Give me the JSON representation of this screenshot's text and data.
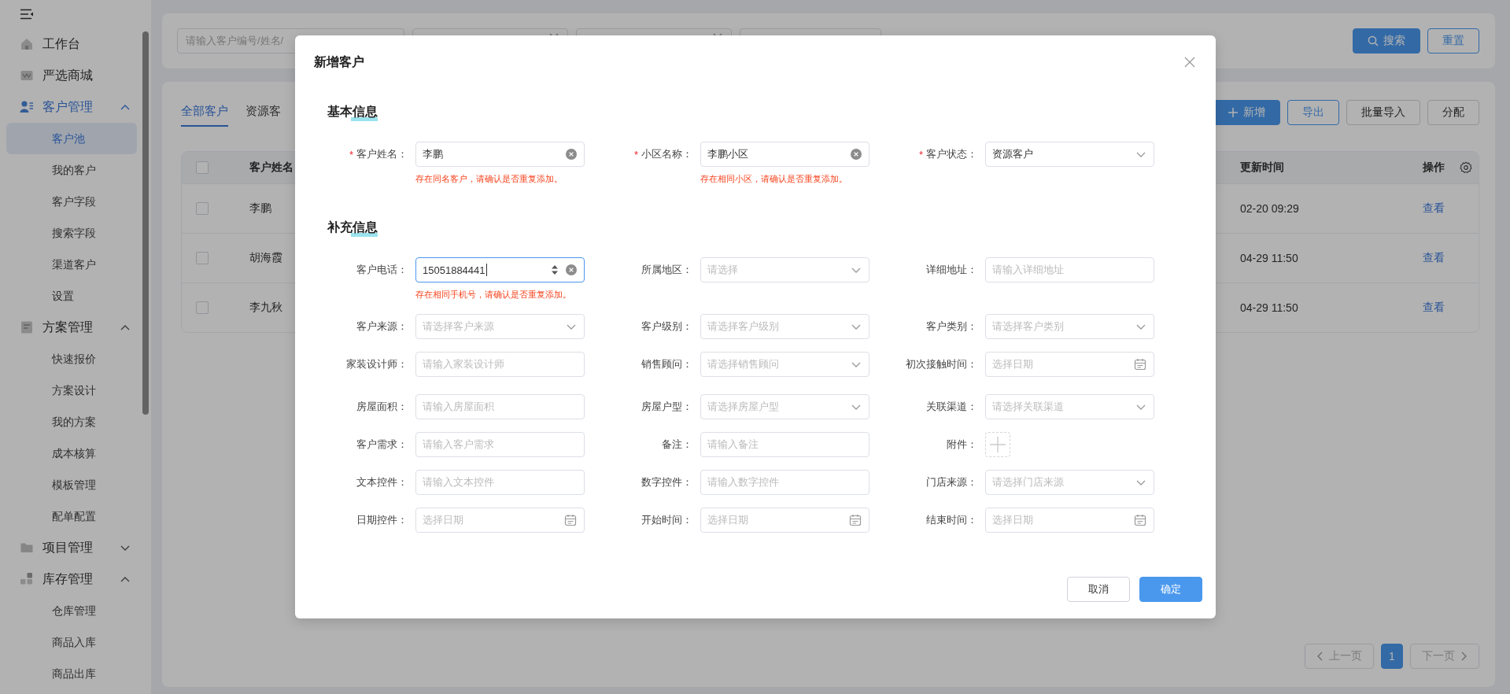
{
  "sidebar": {
    "items": [
      {
        "label": "工作台",
        "active": false
      },
      {
        "label": "严选商城",
        "active": false
      },
      {
        "label": "客户管理",
        "active": true,
        "expanded": true,
        "children": [
          {
            "label": "客户池",
            "selected": true
          },
          {
            "label": "我的客户",
            "selected": false
          },
          {
            "label": "客户字段",
            "selected": false
          },
          {
            "label": "搜索字段",
            "selected": false
          },
          {
            "label": "渠道客户",
            "selected": false
          },
          {
            "label": "设置",
            "selected": false
          }
        ]
      },
      {
        "label": "方案管理",
        "active": false,
        "expanded": true,
        "children": [
          {
            "label": "快速报价",
            "selected": false
          },
          {
            "label": "方案设计",
            "selected": false
          },
          {
            "label": "我的方案",
            "selected": false
          },
          {
            "label": "成本核算",
            "selected": false
          },
          {
            "label": "模板管理",
            "selected": false
          },
          {
            "label": "配单配置",
            "selected": false
          }
        ]
      },
      {
        "label": "项目管理",
        "active": false,
        "expanded": false
      },
      {
        "label": "库存管理",
        "active": false,
        "expanded": true,
        "children": [
          {
            "label": "仓库管理",
            "selected": false
          },
          {
            "label": "商品入库",
            "selected": false
          },
          {
            "label": "商品出库",
            "selected": false
          }
        ]
      }
    ]
  },
  "filter_bar": {
    "fields": [
      {
        "kind": "input",
        "placeholder": "请输入客户编号/姓名/"
      },
      {
        "kind": "select"
      },
      {
        "kind": "select"
      },
      {
        "kind": "input"
      }
    ],
    "buttons": [
      {
        "label": "搜索",
        "kind": "search"
      },
      {
        "label": "重置",
        "kind": "outline"
      }
    ]
  },
  "tabs": [
    {
      "label": "全部客户",
      "selected": true
    },
    {
      "label": "资源客",
      "selected": false
    }
  ],
  "toolbar": [
    {
      "label": "新增",
      "kind": "add"
    },
    {
      "label": "导出",
      "kind": "outline"
    },
    {
      "label": "批量导入",
      "kind": "default"
    },
    {
      "label": "分配",
      "kind": "default"
    }
  ],
  "table": {
    "select_all": {
      "checked": false
    },
    "columns": [
      "客户姓名",
      "更新时间",
      "操作"
    ],
    "rows": [
      {
        "checked": false,
        "name": "李鹏",
        "updated": "02-20 09:29",
        "action": "查看"
      },
      {
        "checked": false,
        "name": "胡海霞",
        "updated": "04-29 11:50",
        "action": "查看"
      },
      {
        "checked": false,
        "name": "李九秋",
        "updated": "04-29 11:50",
        "action": "查看"
      }
    ]
  },
  "pagination": {
    "prev": {
      "label": "上一页",
      "disabled": true
    },
    "pages": [
      {
        "label": "1",
        "selected": true
      }
    ],
    "next": {
      "label": "下一页",
      "disabled": true
    }
  },
  "dialog": {
    "title": "新增客户",
    "sections": [
      {
        "title": "基本信息",
        "rows": [
          [
            {
              "label": "客户姓名：",
              "required_mark": "*",
              "kind": "text",
              "value": "李鹏",
              "clearable": true,
              "focused": false,
              "error": "存在同名客户，请确认是否重复添加。"
            },
            {
              "label": "小区名称：",
              "required_mark": "*",
              "kind": "text",
              "value": "李鹏小区",
              "clearable": true,
              "focused": false,
              "error": "存在相同小区，请确认是否重复添加。"
            },
            {
              "label": "客户状态：",
              "required_mark": "*",
              "kind": "select",
              "value": "资源客户",
              "focused": false
            }
          ]
        ]
      },
      {
        "title": "补充信息",
        "rows": [
          [
            {
              "label": "客户电话：",
              "kind": "number",
              "value": "15051884441",
              "clearable": true,
              "focused": true,
              "error": "存在相同手机号，请确认是否重复添加。"
            },
            {
              "label": "所属地区：",
              "kind": "select",
              "placeholder": "请选择",
              "focused": false
            },
            {
              "label": "详细地址：",
              "kind": "text",
              "placeholder": "请输入详细地址",
              "focused": false
            }
          ],
          [
            {
              "label": "客户来源：",
              "kind": "select",
              "placeholder": "请选择客户来源",
              "focused": false
            },
            {
              "label": "客户级别：",
              "kind": "select",
              "placeholder": "请选择客户级别",
              "focused": false
            },
            {
              "label": "客户类别：",
              "kind": "select",
              "placeholder": "请选择客户类别",
              "focused": false
            }
          ],
          [
            {
              "label": "家装设计师：",
              "kind": "text",
              "placeholder": "请输入家装设计师",
              "focused": false
            },
            {
              "label": "销售顾问：",
              "kind": "select",
              "placeholder": "请选择销售顾问",
              "focused": false
            },
            {
              "label": "初次接触时间：",
              "kind": "date",
              "placeholder": "选择日期",
              "focused": false
            }
          ],
          [
            {
              "label": "房屋面积：",
              "kind": "text",
              "placeholder": "请输入房屋面积",
              "focused": false
            },
            {
              "label": "房屋户型：",
              "kind": "select",
              "placeholder": "请选择房屋户型",
              "focused": false
            },
            {
              "label": "关联渠道：",
              "kind": "select",
              "placeholder": "请选择关联渠道",
              "focused": false
            }
          ],
          [
            {
              "label": "客户需求：",
              "kind": "text",
              "placeholder": "请输入客户需求",
              "focused": false
            },
            {
              "label": "备注：",
              "kind": "text",
              "placeholder": "请输入备注",
              "focused": false
            },
            {
              "label": "附件：",
              "kind": "upload"
            }
          ],
          [
            {
              "label": "文本控件：",
              "kind": "text",
              "placeholder": "请输入文本控件",
              "focused": false
            },
            {
              "label": "数字控件：",
              "kind": "text",
              "placeholder": "请输入数字控件",
              "focused": false
            },
            {
              "label": "门店来源：",
              "kind": "select",
              "placeholder": "请选择门店来源",
              "focused": false
            }
          ],
          [
            {
              "label": "日期控件：",
              "kind": "date",
              "placeholder": "选择日期",
              "focused": false
            },
            {
              "label": "开始时间：",
              "kind": "date",
              "placeholder": "选择日期",
              "focused": false
            },
            {
              "label": "结束时间：",
              "kind": "date",
              "placeholder": "选择日期",
              "focused": false
            }
          ]
        ]
      }
    ],
    "buttons": [
      {
        "label": "取消",
        "kind": "default"
      },
      {
        "label": "确定",
        "kind": "primary"
      }
    ]
  }
}
